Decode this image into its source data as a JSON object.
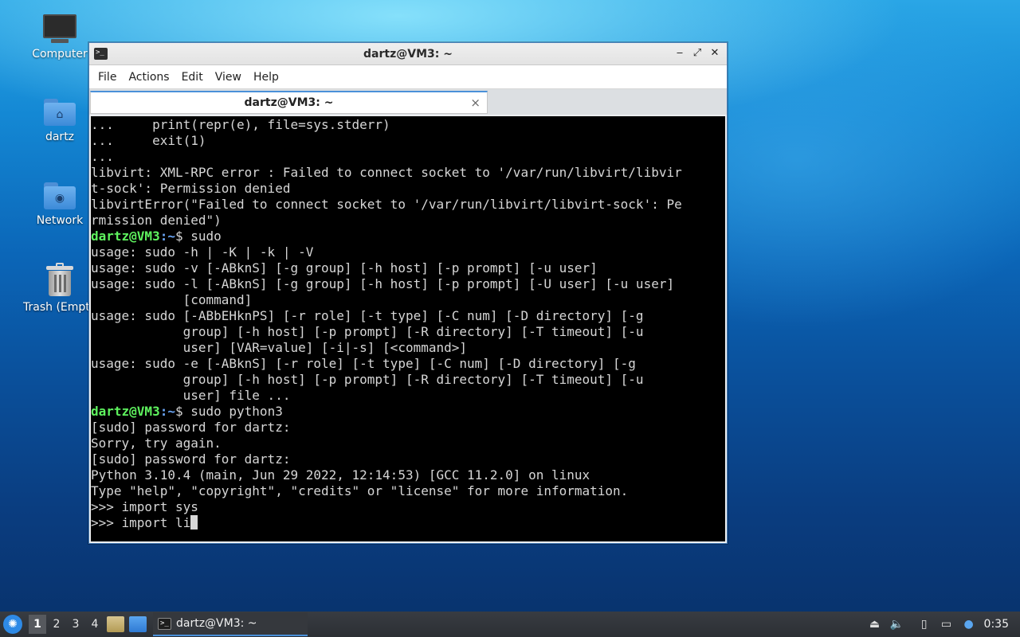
{
  "desktop": {
    "icons": [
      {
        "label": "Computer"
      },
      {
        "label": "dartz"
      },
      {
        "label": "Network"
      },
      {
        "label": "Trash (Empty)"
      }
    ]
  },
  "window": {
    "title": "dartz@VM3: ~",
    "controls": {
      "minimize": "‒",
      "maximize": "⤢",
      "close": "✕"
    },
    "menu": [
      "File",
      "Actions",
      "Edit",
      "View",
      "Help"
    ],
    "tab": {
      "label": "dartz@VM3: ~",
      "close": "×"
    }
  },
  "terminal": {
    "prompt_user": "dartz@VM3",
    "prompt_path": ":~",
    "lines": [
      {
        "text": "...     print(repr(e), file=sys.stderr)"
      },
      {
        "text": "...     exit(1)"
      },
      {
        "text": "..."
      },
      {
        "text": "libvirt: XML-RPC error : Failed to connect socket to '/var/run/libvirt/libvir"
      },
      {
        "text": "t-sock': Permission denied"
      },
      {
        "text": "libvirtError(\"Failed to connect socket to '/var/run/libvirt/libvirt-sock': Pe"
      },
      {
        "text": "rmission denied\")"
      },
      {
        "prompt": true,
        "text": "$ sudo"
      },
      {
        "text": "usage: sudo -h | -K | -k | -V"
      },
      {
        "text": "usage: sudo -v [-ABknS] [-g group] [-h host] [-p prompt] [-u user]"
      },
      {
        "text": "usage: sudo -l [-ABknS] [-g group] [-h host] [-p prompt] [-U user] [-u user]"
      },
      {
        "text": "            [command]"
      },
      {
        "text": "usage: sudo [-ABbEHknPS] [-r role] [-t type] [-C num] [-D directory] [-g"
      },
      {
        "text": "            group] [-h host] [-p prompt] [-R directory] [-T timeout] [-u"
      },
      {
        "text": "            user] [VAR=value] [-i|-s] [<command>]"
      },
      {
        "text": "usage: sudo -e [-ABknS] [-r role] [-t type] [-C num] [-D directory] [-g"
      },
      {
        "text": "            group] [-h host] [-p prompt] [-R directory] [-T timeout] [-u"
      },
      {
        "text": "            user] file ..."
      },
      {
        "prompt": true,
        "text": "$ sudo python3"
      },
      {
        "text": "[sudo] password for dartz:"
      },
      {
        "text": "Sorry, try again."
      },
      {
        "text": "[sudo] password for dartz:"
      },
      {
        "text": "Python 3.10.4 (main, Jun 29 2022, 12:14:53) [GCC 11.2.0] on linux"
      },
      {
        "text": "Type \"help\", \"copyright\", \"credits\" or \"license\" for more information."
      },
      {
        "text": ">>> import sys"
      },
      {
        "text": ">>> import li",
        "cursor": true
      }
    ]
  },
  "taskbar": {
    "start_icon": "start-menu-icon",
    "workspaces": [
      "1",
      "2",
      "3",
      "4"
    ],
    "active_workspace": "1",
    "task_label": "dartz@VM3: ~",
    "clock": "0:35"
  }
}
